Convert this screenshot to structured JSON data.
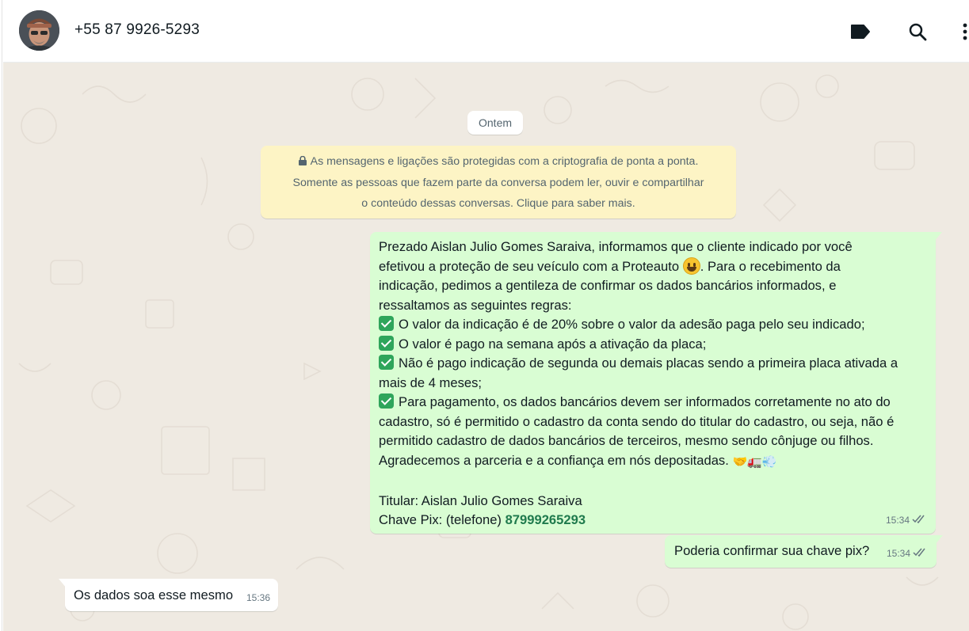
{
  "header": {
    "contact_name": "+55 87 9926-5293",
    "icons": [
      "label-icon",
      "search-icon",
      "menu-icon"
    ]
  },
  "chat": {
    "date_chip": "Ontem",
    "encryption_notice": {
      "line1": "As mensagens e ligações são protegidas com a criptografia de ponta a ponta.",
      "line2": "Somente as pessoas que fazem parte da conversa podem ler, ouvir e compartilhar",
      "line3": "o conteúdo dessas conversas. Clique para saber mais."
    },
    "messages": [
      {
        "direction": "out",
        "lines": [
          "Prezado Aislan Julio Gomes Saraiva, informamos que o cliente indicado por você",
          "efetivou a proteção de seu veículo com a Proteauto",
          ". Para o recebimento da",
          "indicação, pedimos a gentileza de confirmar os dados bancários informados, e",
          "ressaltamos as seguintes regras:",
          "O valor da indicação é de 20% sobre o valor da adesão paga pelo seu indicado;",
          "O valor é pago na semana após a ativação da placa;",
          "Não é pago indicação de segunda ou demais placas sendo a primeira placa ativada a",
          "mais de 4 meses;",
          "Para pagamento, os dados bancários devem ser informados corretamente no ato do",
          "cadastro, só é permitido o cadastro da conta sendo do titular do cadastro, ou seja, não é",
          "permitido cadastro de dados bancários de terceiros, mesmo sendo cônjuge ou filhos.",
          "Agradecemos a parceria e a confiança em nós depositadas.",
          "Titular: Aislan Julio Gomes Saraiva",
          "Chave Pix: (telefone) ",
          "87999265293"
        ],
        "time": "15:34",
        "status": "read"
      },
      {
        "direction": "out",
        "text": "Poderia confirmar sua chave pix?",
        "time": "15:34",
        "status": "read"
      },
      {
        "direction": "in",
        "text": "Os dados soa esse mesmo",
        "time": "15:36"
      }
    ]
  },
  "colors": {
    "outgoing_bubble": "#d9fdd3",
    "incoming_bubble": "#ffffff",
    "chat_background": "#efeae2",
    "encryption_background": "#fdf4c5",
    "pix_link": "#1f7a4d",
    "checkmark": "#2ea55b"
  }
}
